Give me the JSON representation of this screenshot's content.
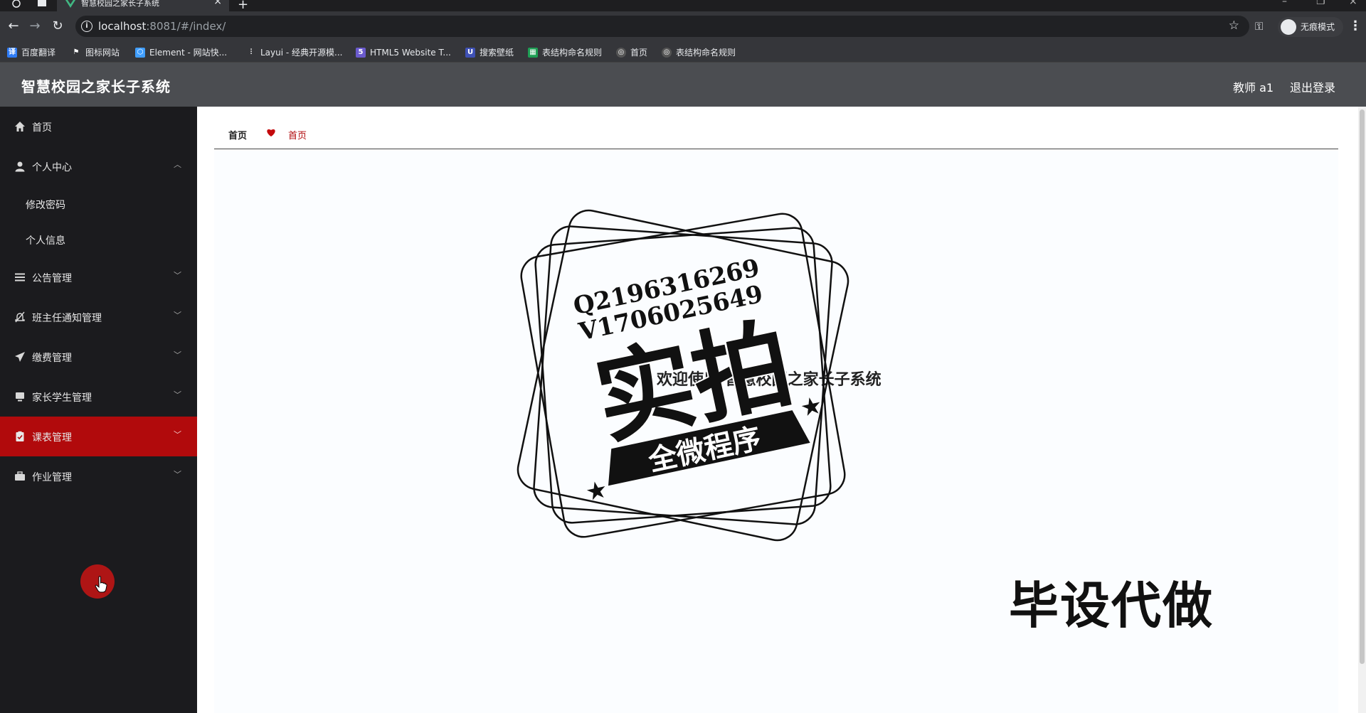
{
  "browser": {
    "tab_title": "智慧校园之家长子系统",
    "url_host": "localhost",
    "url_rest": ":8081/#/index/",
    "incognito_label": "无痕模式",
    "bookmarks": [
      {
        "label": "百度翻译",
        "color": "#2f7cf6"
      },
      {
        "label": "图标网站",
        "color": "#555555"
      },
      {
        "label": "Element - 网站快...",
        "color": "#409eff"
      },
      {
        "label": "Layui - 经典开源模...",
        "color": "#555555"
      },
      {
        "label": "HTML5 Website T...",
        "color": "#6a5acd"
      },
      {
        "label": "搜索壁纸",
        "color": "#3f51b5"
      },
      {
        "label": "表结构命名规则",
        "color": "#1e9e54"
      },
      {
        "label": "首页",
        "color": "#777777"
      },
      {
        "label": "表结构命名规则",
        "color": "#777777"
      }
    ]
  },
  "header": {
    "title": "智慧校园之家长子系统",
    "user": "教师 a1",
    "logout": "退出登录"
  },
  "sidebar": {
    "items": [
      {
        "label": "首页",
        "icon": "home-icon"
      },
      {
        "label": "个人中心",
        "icon": "user-icon",
        "expanded": true
      },
      {
        "label": "公告管理",
        "icon": "list-icon"
      },
      {
        "label": "班主任通知管理",
        "icon": "bell-off-icon"
      },
      {
        "label": "缴费管理",
        "icon": "send-icon"
      },
      {
        "label": "家长学生管理",
        "icon": "monitor-icon"
      },
      {
        "label": "课表管理",
        "icon": "checklist-icon",
        "active": true
      },
      {
        "label": "作业管理",
        "icon": "briefcase-icon"
      }
    ],
    "subitems": [
      {
        "label": "修改密码"
      },
      {
        "label": "个人信息"
      }
    ]
  },
  "breadcrumb": {
    "home": "首页",
    "current": "首页"
  },
  "main": {
    "welcome": "欢迎使用 智慧校园之家长子系统"
  },
  "watermark": {
    "line1": "Q2196316269",
    "line2": "V1706025649",
    "big": "实拍",
    "banner": "全微程序",
    "side": "毕设代做"
  },
  "colors": {
    "accent": "#b10a0c",
    "sidebar_bg": "#1b1b1e",
    "header_bg": "#4b4d51"
  }
}
